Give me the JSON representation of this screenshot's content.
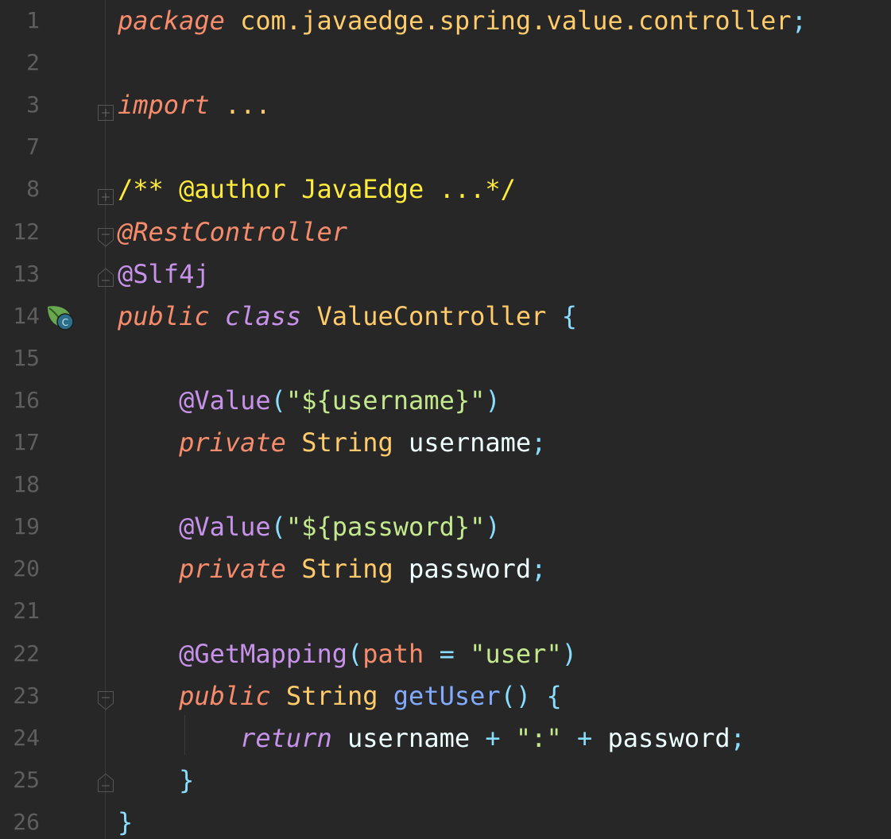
{
  "editor": {
    "lines": [
      {
        "num": "1",
        "tokens": [
          [
            "kw",
            "package"
          ],
          [
            "sp",
            " "
          ],
          [
            "pkg",
            "com.javaedge.spring.value.controller"
          ],
          [
            "punc",
            ";"
          ]
        ]
      },
      {
        "num": "2",
        "tokens": []
      },
      {
        "num": "3",
        "tokens": [
          [
            "kw",
            "import"
          ],
          [
            "sp",
            " "
          ],
          [
            "pkg",
            "..."
          ]
        ]
      },
      {
        "num": "7",
        "tokens": []
      },
      {
        "num": "8",
        "tokens": [
          [
            "doc",
            "/** @author JavaEdge ...*/"
          ]
        ]
      },
      {
        "num": "12",
        "tokens": [
          [
            "kw",
            "@RestController"
          ]
        ]
      },
      {
        "num": "13",
        "tokens": [
          [
            "ann",
            "@Slf4j"
          ]
        ]
      },
      {
        "num": "14",
        "tokens": [
          [
            "kw",
            "public"
          ],
          [
            "sp",
            " "
          ],
          [
            "kw2",
            "class"
          ],
          [
            "sp",
            " "
          ],
          [
            "type",
            "ValueController"
          ],
          [
            "sp",
            " "
          ],
          [
            "punc",
            "{"
          ]
        ]
      },
      {
        "num": "15",
        "tokens": []
      },
      {
        "num": "16",
        "tokens": [
          [
            "sp",
            "    "
          ],
          [
            "ann",
            "@Value"
          ],
          [
            "punc",
            "("
          ],
          [
            "str",
            "\"${username}\""
          ],
          [
            "punc",
            ")"
          ]
        ]
      },
      {
        "num": "17",
        "tokens": [
          [
            "sp",
            "    "
          ],
          [
            "kw",
            "private"
          ],
          [
            "sp",
            " "
          ],
          [
            "type",
            "String"
          ],
          [
            "sp",
            " "
          ],
          [
            "var",
            "username"
          ],
          [
            "punc",
            ";"
          ]
        ]
      },
      {
        "num": "18",
        "tokens": []
      },
      {
        "num": "19",
        "tokens": [
          [
            "sp",
            "    "
          ],
          [
            "ann",
            "@Value"
          ],
          [
            "punc",
            "("
          ],
          [
            "str",
            "\"${password}\""
          ],
          [
            "punc",
            ")"
          ]
        ]
      },
      {
        "num": "20",
        "tokens": [
          [
            "sp",
            "    "
          ],
          [
            "kw",
            "private"
          ],
          [
            "sp",
            " "
          ],
          [
            "type",
            "String"
          ],
          [
            "sp",
            " "
          ],
          [
            "var",
            "password"
          ],
          [
            "punc",
            ";"
          ]
        ]
      },
      {
        "num": "21",
        "tokens": []
      },
      {
        "num": "22",
        "tokens": [
          [
            "sp",
            "    "
          ],
          [
            "ann",
            "@GetMapping"
          ],
          [
            "punc",
            "("
          ],
          [
            "param",
            "path"
          ],
          [
            "sp",
            " "
          ],
          [
            "punc",
            "="
          ],
          [
            "sp",
            " "
          ],
          [
            "str",
            "\"user\""
          ],
          [
            "punc",
            ")"
          ]
        ]
      },
      {
        "num": "23",
        "tokens": [
          [
            "sp",
            "    "
          ],
          [
            "kw",
            "public"
          ],
          [
            "sp",
            " "
          ],
          [
            "type",
            "String"
          ],
          [
            "sp",
            " "
          ],
          [
            "fn",
            "getUser"
          ],
          [
            "punc",
            "()"
          ],
          [
            "sp",
            " "
          ],
          [
            "punc",
            "{"
          ]
        ]
      },
      {
        "num": "24",
        "tokens": [
          [
            "sp",
            "        "
          ],
          [
            "kw2",
            "return"
          ],
          [
            "sp",
            " "
          ],
          [
            "var",
            "username"
          ],
          [
            "sp",
            " "
          ],
          [
            "punc",
            "+"
          ],
          [
            "sp",
            " "
          ],
          [
            "str",
            "\":\""
          ],
          [
            "sp",
            " "
          ],
          [
            "punc",
            "+"
          ],
          [
            "sp",
            " "
          ],
          [
            "var",
            "password"
          ],
          [
            "punc",
            ";"
          ]
        ]
      },
      {
        "num": "25",
        "tokens": [
          [
            "sp",
            "    "
          ],
          [
            "punc",
            "}"
          ]
        ]
      },
      {
        "num": "26",
        "tokens": [
          [
            "punc",
            "}"
          ]
        ]
      }
    ],
    "gutter_icon": "spring-bean-class-icon",
    "gutter_icon_letter": "C",
    "colors": {
      "background": "#272727",
      "line_number": "#5e5e5e",
      "keyword": "#f78c6c",
      "keyword2": "#c792ea",
      "package": "#ffcb6b",
      "punctuation": "#89ddff",
      "annotation": "#c792ea",
      "doc_comment": "#ffeb3b",
      "string": "#c3e88d",
      "function": "#82aaff"
    }
  }
}
